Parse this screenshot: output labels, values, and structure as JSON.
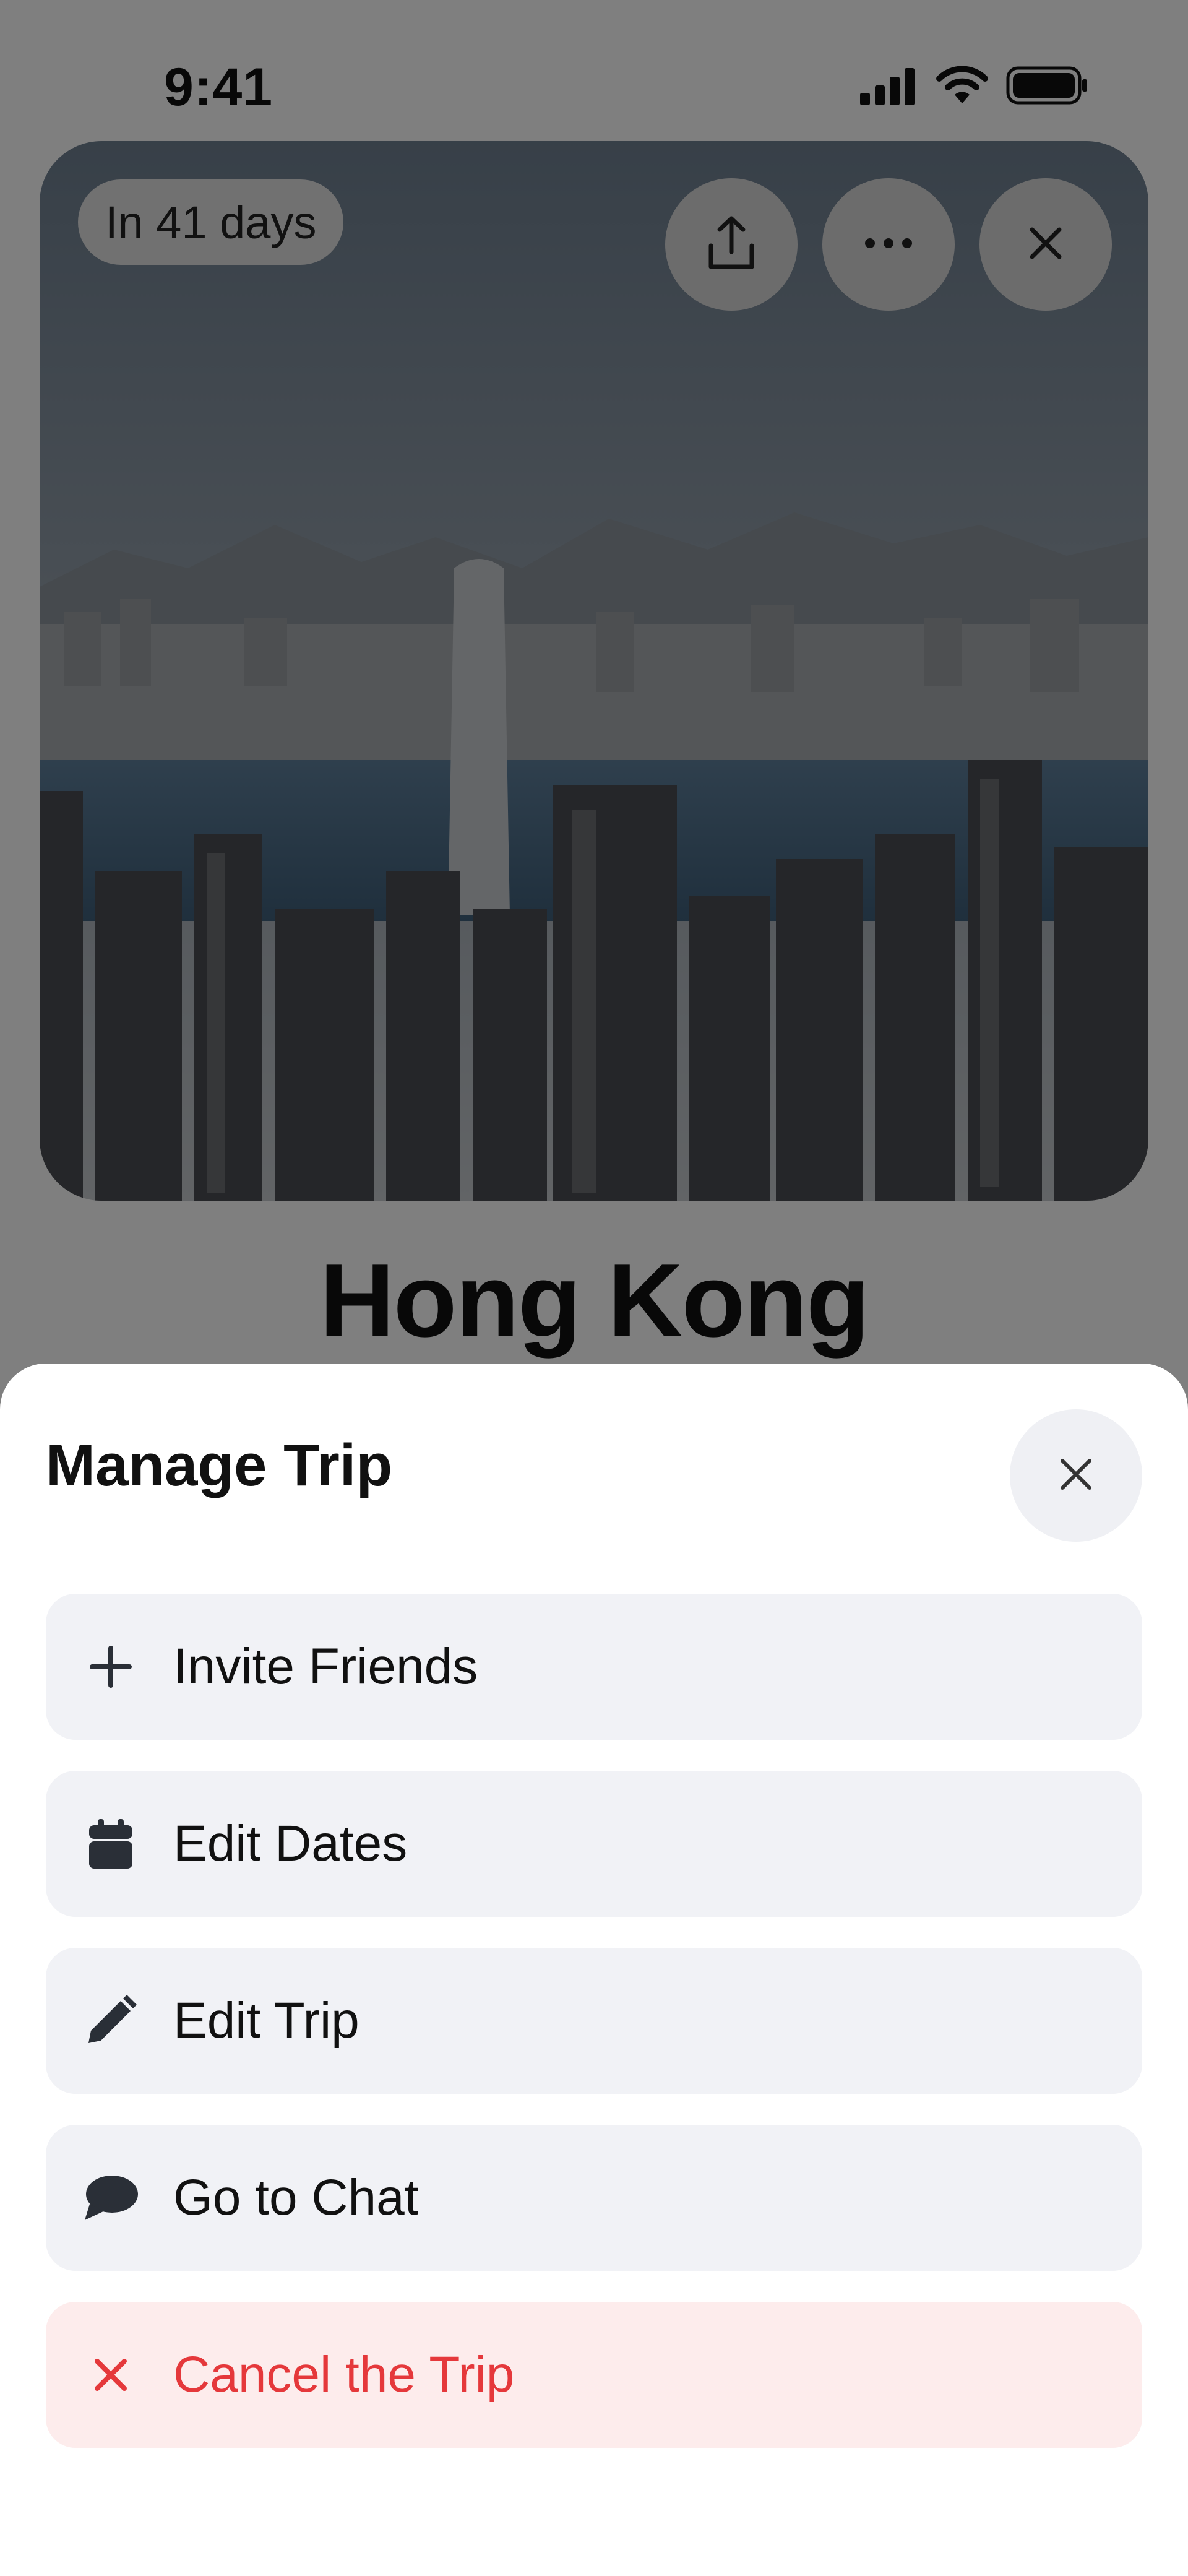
{
  "status_bar": {
    "time": "9:41"
  },
  "trip": {
    "days_badge": "In 41 days",
    "title": "Hong Kong",
    "actions": {
      "share_icon": "share-upload-icon",
      "more_icon": "ellipsis-icon",
      "close_icon": "close-icon"
    }
  },
  "sheet": {
    "title": "Manage Trip",
    "close_icon": "close-icon",
    "items": [
      {
        "label": "Invite Friends",
        "icon": "plus-icon"
      },
      {
        "label": "Edit Dates",
        "icon": "calendar-icon"
      },
      {
        "label": "Edit Trip",
        "icon": "pencil-icon"
      },
      {
        "label": "Go to Chat",
        "icon": "chat-bubble-icon"
      },
      {
        "label": "Cancel the Trip",
        "icon": "x-icon",
        "danger": true
      }
    ]
  },
  "colors": {
    "danger_text": "#e5383b",
    "danger_bg": "#fdecec",
    "row_bg": "#f1f2f6",
    "overlay": "rgba(0,0,0,0.5)"
  }
}
